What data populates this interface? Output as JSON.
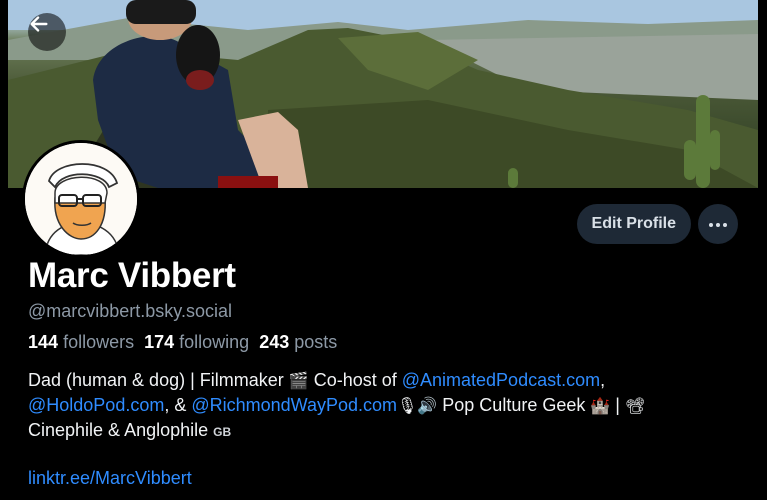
{
  "profile": {
    "display_name": "Marc Vibbert",
    "handle": "@marcvibbert.bsky.social",
    "stats": {
      "followers_count": "144",
      "followers_label": "followers",
      "following_count": "174",
      "following_label": "following",
      "posts_count": "243",
      "posts_label": "posts"
    },
    "bio": {
      "t1": "Dad (human & dog) | Filmmaker ",
      "e1": "🎬",
      "t2": " Co-host of ",
      "link1": "@AnimatedPodcast.com",
      "t3": ",",
      "link2": "@HoldoPod.com",
      "t4": ", & ",
      "link3": "@RichmondWayPod.com",
      "e2": "🎙🔊",
      "t5": " Pop Culture Geek ",
      "e3": "🏰",
      "t6": " | ",
      "e4": "📽",
      "t7": "Cinephile & Anglophile ",
      "flag": "GB"
    },
    "website": "linktr.ee/MarcVibbert"
  },
  "actions": {
    "edit_label": "Edit Profile",
    "more_icon": "more-horizontal-icon"
  },
  "navigation": {
    "back_icon": "arrow-left-icon"
  },
  "colors": {
    "background": "#000000",
    "link": "#2f8cff",
    "muted_text": "#8d99a6",
    "button_bg": "#1e2936",
    "avatar_orange": "#f0a450"
  }
}
